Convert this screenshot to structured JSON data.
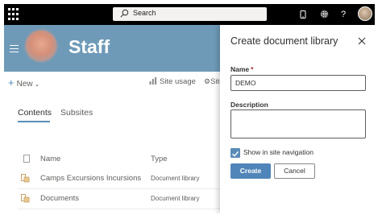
{
  "topbar": {
    "search_placeholder": "Search",
    "help_glyph": "?"
  },
  "site": {
    "title": "Staff"
  },
  "commandbar": {
    "new_label": "New",
    "site_usage_label": "Site usage",
    "site_settings_label": "Site"
  },
  "tabs": [
    {
      "label": "Contents",
      "active": true
    },
    {
      "label": "Subsites",
      "active": false
    }
  ],
  "table": {
    "columns": [
      "Name",
      "Type"
    ],
    "rows": [
      {
        "name": "Camps Excursions Incursions",
        "type": "Document library"
      },
      {
        "name": "Documents",
        "type": "Document library"
      }
    ]
  },
  "panel": {
    "title": "Create document library",
    "name_label": "Name",
    "required_marker": "*",
    "name_value": "DEMO",
    "description_label": "Description",
    "description_value": "",
    "show_in_nav_label": "Show in site navigation",
    "show_in_nav_checked": true,
    "create_label": "Create",
    "cancel_label": "Cancel"
  },
  "colors": {
    "suite_bar": "#000000",
    "site_header": "#6e9ab8",
    "accent": "#4f85b8"
  }
}
